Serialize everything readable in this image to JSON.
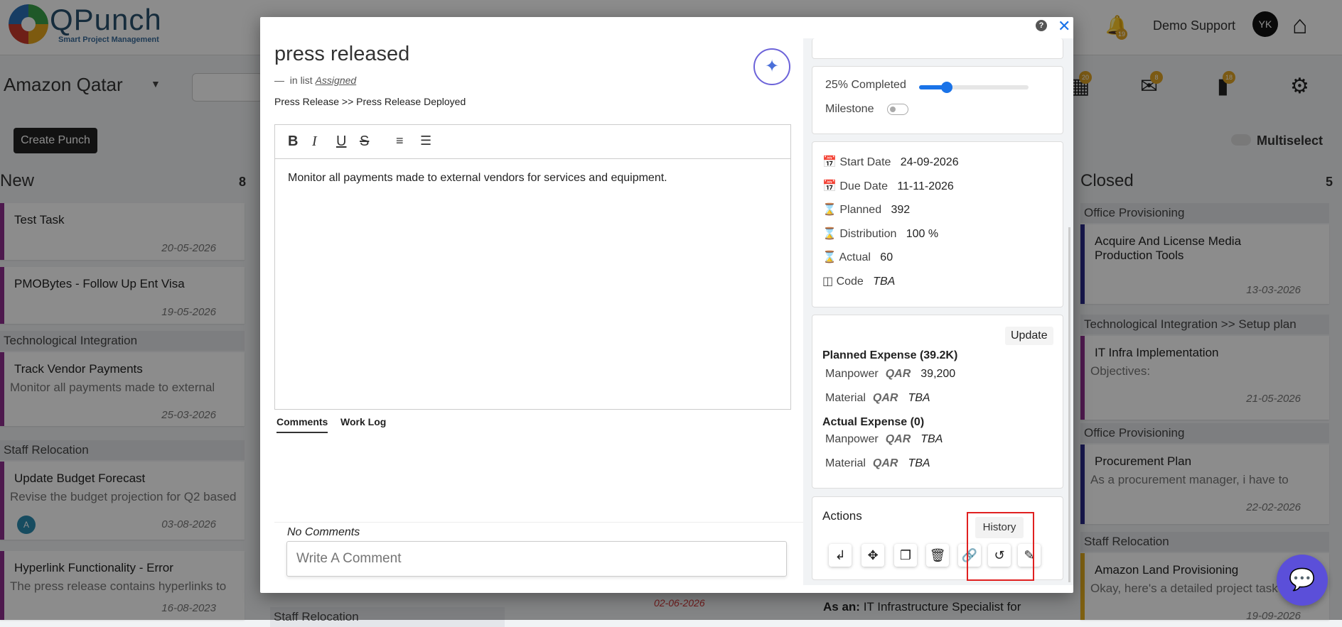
{
  "header": {
    "brand": "QPunch",
    "tagline": "Smart Project Management",
    "user": "Demo Support",
    "avatar_initials": "YK",
    "bell_count": "19"
  },
  "subbar": {
    "project": "Amazon Qatar",
    "create_button": "Create Punch",
    "multiselect_label": "Multiselect",
    "badges": [
      "20",
      "8",
      "18"
    ]
  },
  "board": {
    "new": {
      "title": "New",
      "count": "8",
      "cards": [
        {
          "title": "Test Task",
          "date": "20-05-2026"
        },
        {
          "title": "PMOBytes - Follow Up Ent Visa",
          "date": "19-05-2026"
        }
      ],
      "groups": [
        {
          "name": "Technological Integration",
          "card": {
            "title": "Track Vendor Payments",
            "desc": "Monitor all payments made to external",
            "date": "25-03-2026"
          }
        },
        {
          "name": "Staff Relocation",
          "card": {
            "title": "Update Budget Forecast",
            "desc": "Revise the budget projection for Q2 based",
            "date": "03-08-2026",
            "avatar": "A"
          }
        },
        {
          "name": "",
          "card": {
            "title": "Hyperlink Functionality - Error",
            "desc": "The press release contains hyperlinks to",
            "date": "16-08-2023"
          }
        }
      ]
    },
    "closed": {
      "title": "Closed",
      "count": "5",
      "groups": [
        {
          "name": "Office Provisioning",
          "card": {
            "title": "Acquire And License Media Production Tools",
            "date": "13-03-2026"
          }
        },
        {
          "name": "Technological Integration >> Setup plan",
          "card": {
            "title": "IT Infra Implementation",
            "desc": "Objectives:",
            "date": "21-05-2026"
          }
        },
        {
          "name": "Office Provisioning",
          "card": {
            "title": "Procurement Plan",
            "desc": "As a procurement manager, i have to",
            "date": "22-02-2026"
          }
        },
        {
          "name": "Staff Relocation",
          "card": {
            "title": "Amazon Land Provisioning",
            "desc": "Okay, here's a detailed project task",
            "date": "19-09-2026"
          }
        }
      ]
    },
    "middle": {
      "group": "Staff Relocation",
      "date": "02-06-2026",
      "as_an": "As an:",
      "as_an_text": "IT Infrastructure Specialist for"
    }
  },
  "modal": {
    "title": "press released",
    "in_list_prefix": "in list",
    "in_list": "Assigned",
    "breadcrumb": "Press Release >>  Press Release Deployed",
    "description": "Monitor all payments made to external vendors for services and equipment.",
    "tabs": [
      "Comments",
      "Work Log"
    ],
    "no_comments": "No Comments",
    "comment_placeholder": "Write A Comment",
    "progress": {
      "label": "25% Completed",
      "percent": 25
    },
    "milestone_label": "Milestone",
    "info": {
      "start_date_label": "Start Date",
      "start_date": "24-09-2026",
      "due_date_label": "Due Date",
      "due_date": "11-11-2026",
      "planned_label": "Planned",
      "planned": "392",
      "distribution_label": "Distribution",
      "distribution": "100 %",
      "actual_label": "Actual",
      "actual": "60",
      "code_label": "Code",
      "code": "TBA"
    },
    "update_button": "Update",
    "planned_expense": {
      "title": "Planned Expense (39.2K)",
      "rows": [
        {
          "label": "Manpower",
          "currency": "QAR",
          "amount": "39,200"
        },
        {
          "label": "Material",
          "currency": "QAR",
          "amount": "TBA"
        }
      ]
    },
    "actual_expense": {
      "title": "Actual Expense (0)",
      "rows": [
        {
          "label": "Manpower",
          "currency": "QAR",
          "amount": "TBA"
        },
        {
          "label": "Material",
          "currency": "QAR",
          "amount": "TBA"
        }
      ]
    },
    "actions_title": "Actions",
    "history_tooltip": "History",
    "action_icons": [
      "branch-icon",
      "move-icon",
      "copy-icon",
      "trash-icon",
      "link-icon",
      "history-icon",
      "edit-icon"
    ]
  }
}
